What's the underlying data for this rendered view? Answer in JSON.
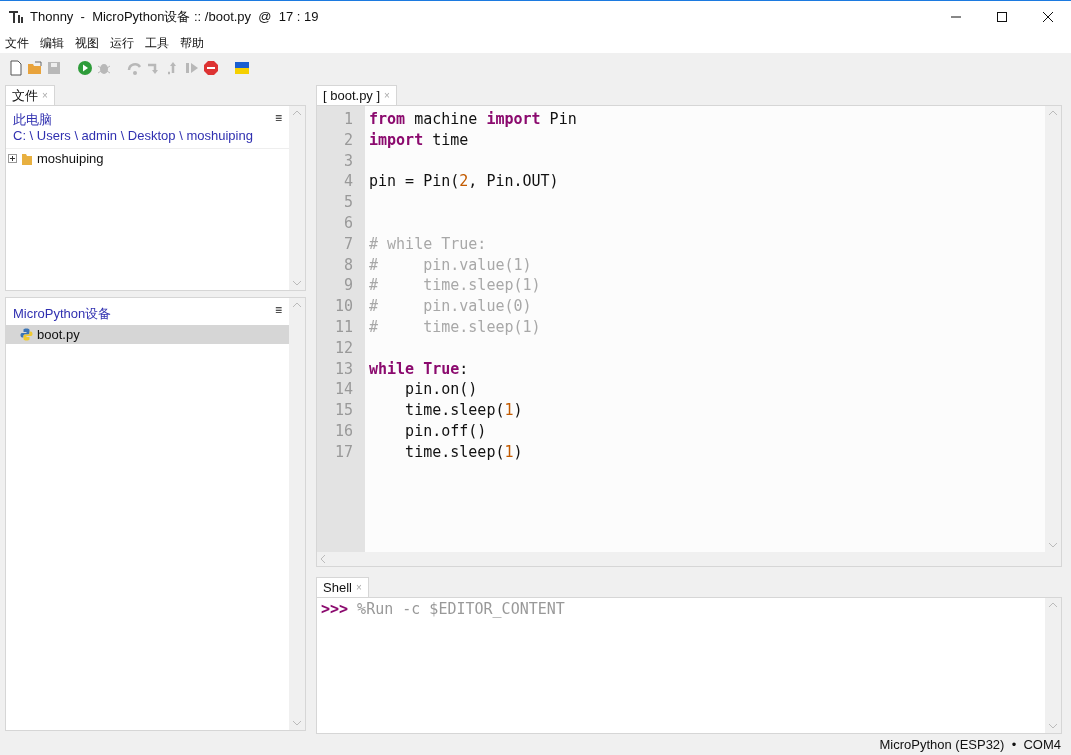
{
  "window": {
    "title": "Thonny  -  MicroPython设备 :: /boot.py  @  17 : 19"
  },
  "menu": [
    "文件",
    "编辑",
    "视图",
    "运行",
    "工具",
    "帮助"
  ],
  "toolbar": [
    {
      "kind": "new",
      "disabled": false
    },
    {
      "kind": "open",
      "disabled": false
    },
    {
      "kind": "save",
      "disabled": true
    },
    {
      "kind": "run",
      "disabled": false
    },
    {
      "kind": "debug",
      "disabled": true
    },
    {
      "kind": "step-over",
      "disabled": true
    },
    {
      "kind": "step-into",
      "disabled": true
    },
    {
      "kind": "step-out",
      "disabled": true
    },
    {
      "kind": "resume",
      "disabled": true
    },
    {
      "kind": "stop",
      "disabled": false
    },
    {
      "kind": "flag"
    }
  ],
  "files_panel": {
    "tab": {
      "label": "文件",
      "close": "×",
      "selected": true
    },
    "local": {
      "title": "此电脑",
      "path": "C: \\ Users \\ admin \\ Desktop \\ moshuiping",
      "menu": "≡",
      "items": [
        {
          "name": "moshuiping",
          "kind": "folder",
          "expanded": false,
          "selected": false
        }
      ]
    },
    "device": {
      "title": "MicroPython设备",
      "menu": "≡",
      "items": [
        {
          "name": "boot.py",
          "kind": "python",
          "selected": true
        }
      ]
    }
  },
  "editor": {
    "tab": {
      "label": "[ boot.py ]",
      "close": "×",
      "selected": true
    },
    "lines": [
      {
        "number": "1",
        "tokens": [
          {
            "kind": "keyword",
            "text": "from"
          },
          {
            "kind": "plain",
            "text": " machine "
          },
          {
            "kind": "keyword",
            "text": "import"
          },
          {
            "kind": "plain",
            "text": " Pin"
          }
        ]
      },
      {
        "number": "2",
        "tokens": [
          {
            "kind": "keyword",
            "text": "import"
          },
          {
            "kind": "plain",
            "text": " time"
          }
        ]
      },
      {
        "number": "3"
      },
      {
        "number": "4",
        "tokens": [
          {
            "kind": "plain",
            "text": "pin = Pin("
          },
          {
            "kind": "number",
            "text": "2"
          },
          {
            "kind": "plain",
            "text": ", Pin.OUT)"
          }
        ]
      },
      {
        "number": "5"
      },
      {
        "number": "6"
      },
      {
        "number": "7",
        "tokens": [
          {
            "kind": "comment",
            "text": "# while True:"
          }
        ]
      },
      {
        "number": "8",
        "tokens": [
          {
            "kind": "comment",
            "text": "#     pin.value(1)"
          }
        ]
      },
      {
        "number": "9",
        "tokens": [
          {
            "kind": "comment",
            "text": "#     time.sleep(1)"
          }
        ]
      },
      {
        "number": "10",
        "tokens": [
          {
            "kind": "comment",
            "text": "#     pin.value(0)"
          }
        ]
      },
      {
        "number": "11",
        "tokens": [
          {
            "kind": "comment",
            "text": "#     time.sleep(1)"
          }
        ]
      },
      {
        "number": "12"
      },
      {
        "number": "13",
        "tokens": [
          {
            "kind": "keyword",
            "text": "while True"
          },
          {
            "kind": "plain",
            "text": ":"
          }
        ]
      },
      {
        "number": "14",
        "tokens": [
          {
            "kind": "plain",
            "text": "    pin.on()"
          }
        ]
      },
      {
        "number": "15",
        "tokens": [
          {
            "kind": "plain",
            "text": "    time.sleep("
          },
          {
            "kind": "number",
            "text": "1"
          },
          {
            "kind": "plain",
            "text": ")"
          }
        ]
      },
      {
        "number": "16",
        "tokens": [
          {
            "kind": "plain",
            "text": "    pin.off()"
          }
        ]
      },
      {
        "number": "17",
        "tokens": [
          {
            "kind": "plain",
            "text": "    time.sleep("
          },
          {
            "kind": "number",
            "text": "1"
          },
          {
            "kind": "plain",
            "text": ")"
          }
        ]
      }
    ]
  },
  "shell": {
    "tab": {
      "label": "Shell",
      "close": "×",
      "selected": true
    },
    "prompt": ">>>",
    "command": " %Run -c $EDITOR_CONTENT"
  },
  "status_bar": {
    "text": "MicroPython (ESP32)  •  COM4"
  }
}
